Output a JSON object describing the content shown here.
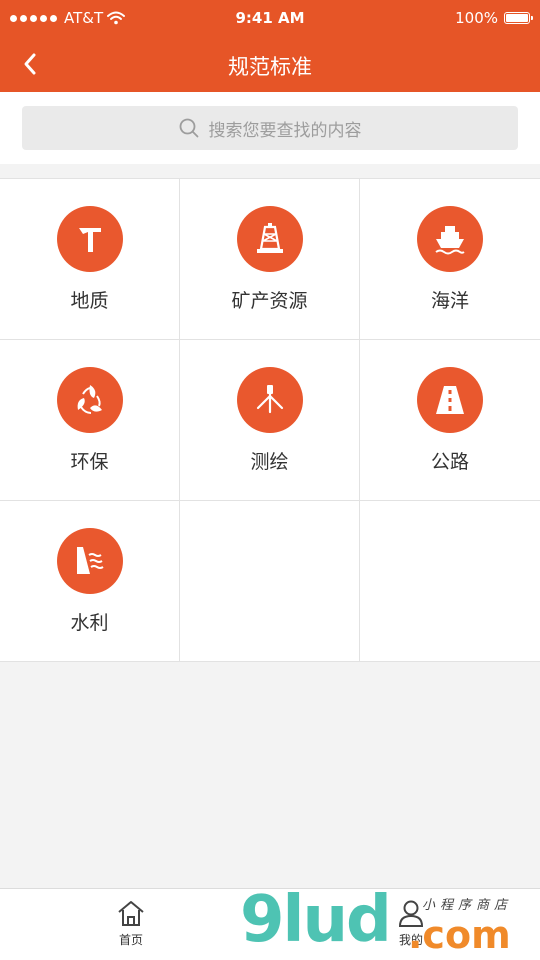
{
  "status": {
    "carrier": "AT&T",
    "time": "9:41 AM",
    "battery": "100%"
  },
  "nav": {
    "title": "规范标准",
    "back_icon": "chevron-left-icon"
  },
  "search": {
    "placeholder": "搜索您要查找的内容"
  },
  "categories": [
    {
      "label": "地质",
      "icon": "hammer-icon"
    },
    {
      "label": "矿产资源",
      "icon": "oil-rig-icon"
    },
    {
      "label": "海洋",
      "icon": "ship-icon"
    },
    {
      "label": "环保",
      "icon": "recycle-leaf-icon"
    },
    {
      "label": "测绘",
      "icon": "tripod-icon"
    },
    {
      "label": "公路",
      "icon": "road-icon"
    },
    {
      "label": "水利",
      "icon": "dam-icon"
    }
  ],
  "tabs": [
    {
      "label": "首页",
      "icon": "home-icon"
    },
    {
      "label": "我的",
      "icon": "user-icon"
    }
  ],
  "watermark": {
    "brand": "9lud",
    "domain": ".com",
    "tagline": "小程序商店"
  },
  "colors": {
    "accent": "#e65527",
    "icon_bg": "#e9582e",
    "watermark_teal": "#4ec3b3",
    "watermark_orange": "#f08a2a"
  }
}
